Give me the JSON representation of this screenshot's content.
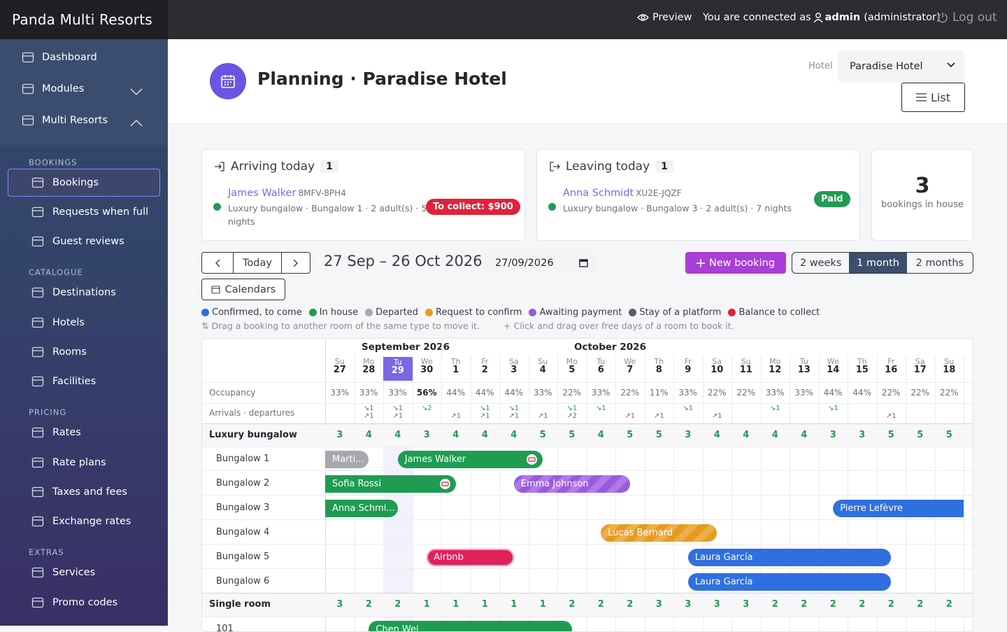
{
  "topbar": {
    "brand": "Panda Multi Resorts",
    "preview": "Preview",
    "connected_prefix": "You are connected as",
    "user": "admin",
    "role": "(administrator)",
    "logout": "Log out"
  },
  "sidebar": {
    "top": [
      {
        "label": "Dashboard",
        "icon": "dashboard-icon"
      },
      {
        "label": "Modules",
        "icon": "modules-icon"
      },
      {
        "label": "Multi Resorts",
        "icon": "building-icon"
      }
    ],
    "sections": [
      {
        "title": "BOOKINGS",
        "items": [
          {
            "label": "Bookings",
            "icon": "calendar-icon",
            "active": true
          },
          {
            "label": "Requests when full",
            "icon": "envelope-icon"
          },
          {
            "label": "Guest reviews",
            "icon": "star-icon"
          }
        ]
      },
      {
        "title": "CATALOGUE",
        "items": [
          {
            "label": "Destinations",
            "icon": "map-icon"
          },
          {
            "label": "Hotels",
            "icon": "hotel-icon"
          },
          {
            "label": "Rooms",
            "icon": "bed-icon"
          },
          {
            "label": "Facilities",
            "icon": "bell-icon"
          }
        ]
      },
      {
        "title": "PRICING",
        "items": [
          {
            "label": "Rates",
            "icon": "coins-icon"
          },
          {
            "label": "Rate plans",
            "icon": "tag-icon"
          },
          {
            "label": "Taxes and fees",
            "icon": "receipt-icon"
          },
          {
            "label": "Exchange rates",
            "icon": "exchange-icon"
          }
        ]
      },
      {
        "title": "EXTRAS",
        "items": [
          {
            "label": "Services",
            "icon": "service-icon"
          },
          {
            "label": "Promo codes",
            "icon": "ticket-icon"
          }
        ]
      }
    ]
  },
  "header": {
    "title": "Planning · Paradise Hotel",
    "hotel_label": "Hotel",
    "hotel_value": "Paradise Hotel",
    "list_button": "List"
  },
  "arriving": {
    "title": "Arriving today",
    "count": "1",
    "guest": "James Walker",
    "ref": "8MFV-8PH4",
    "detail_line1": "Luxury bungalow · Bungalow 1 · 2 adult(s) · 5",
    "detail_line2": "nights",
    "badge": "To collect: $900",
    "badge_color": "#e0213a"
  },
  "leaving": {
    "title": "Leaving today",
    "count": "1",
    "guest": "Anna Schmidt",
    "ref": "XU2E-JQZF",
    "detail": "Luxury bungalow · Bungalow 3 · 2 adult(s) · 7 nights",
    "badge": "Paid",
    "badge_color": "#1f9c52"
  },
  "inhouse": {
    "count": "3",
    "label": "bookings in house"
  },
  "toolbar": {
    "today": "Today",
    "range": "27 Sep – 26 Oct 2026",
    "date_value": "27/09/2026",
    "new_booking": "New booking",
    "views": [
      "2 weeks",
      "1 month",
      "2 months"
    ],
    "active_view": "1 month",
    "calendars": "Calendars"
  },
  "legend": [
    {
      "label": "Confirmed, to come",
      "color": "#2f6fe0"
    },
    {
      "label": "In house",
      "color": "#1f9c52"
    },
    {
      "label": "Departed",
      "color": "#a6a8ae"
    },
    {
      "label": "Request to confirm",
      "color": "#e69b1e"
    },
    {
      "label": "Awaiting payment",
      "color": "#9b59e0"
    },
    {
      "label": "Stay of a platform",
      "color": "#5a5c64"
    },
    {
      "label": "Balance to collect",
      "color": "#e0213a"
    }
  ],
  "hints": [
    "⇅ Drag a booking to another room of the same type to move it.",
    "+ Click and drag over free days of a room to book it."
  ],
  "planning": {
    "months": [
      "September 2026",
      "October 2026"
    ],
    "days": [
      {
        "dn": "Su",
        "dd": "27"
      },
      {
        "dn": "Mo",
        "dd": "28"
      },
      {
        "dn": "Tu",
        "dd": "29"
      },
      {
        "dn": "We",
        "dd": "30"
      },
      {
        "dn": "Th",
        "dd": "1"
      },
      {
        "dn": "Fr",
        "dd": "2"
      },
      {
        "dn": "Sa",
        "dd": "3"
      },
      {
        "dn": "Su",
        "dd": "4"
      },
      {
        "dn": "Mo",
        "dd": "5"
      },
      {
        "dn": "Tu",
        "dd": "6"
      },
      {
        "dn": "We",
        "dd": "7"
      },
      {
        "dn": "Th",
        "dd": "8"
      },
      {
        "dn": "Fr",
        "dd": "9"
      },
      {
        "dn": "Sa",
        "dd": "10"
      },
      {
        "dn": "Su",
        "dd": "11"
      },
      {
        "dn": "Mo",
        "dd": "12"
      },
      {
        "dn": "Tu",
        "dd": "13"
      },
      {
        "dn": "We",
        "dd": "14"
      },
      {
        "dn": "Th",
        "dd": "15"
      },
      {
        "dn": "Fr",
        "dd": "16"
      },
      {
        "dn": "Sa",
        "dd": "17"
      },
      {
        "dn": "Su",
        "dd": "18"
      }
    ],
    "today_index": 2,
    "occupancy_label": "Occupancy",
    "occupancy": [
      "33%",
      "33%",
      "33%",
      "56%",
      "44%",
      "44%",
      "44%",
      "33%",
      "22%",
      "33%",
      "22%",
      "11%",
      "33%",
      "22%",
      "22%",
      "33%",
      "33%",
      "44%",
      "44%",
      "22%",
      "22%",
      "22%"
    ],
    "arrivals_label": "Arrivals · departures",
    "arrivals": [
      [
        "",
        ""
      ],
      [
        "↘1",
        "↗1"
      ],
      [
        "↘1",
        "↗1"
      ],
      [
        "↘2",
        ""
      ],
      [
        "",
        "↗1"
      ],
      [
        "↘1",
        "↗1"
      ],
      [
        "↘1",
        "↗1"
      ],
      [
        "",
        "↗1"
      ],
      [
        "↘1",
        "↗2"
      ],
      [
        "↘1",
        ""
      ],
      [
        "",
        "↗1"
      ],
      [
        "",
        "↗1"
      ],
      [
        "↘1",
        ""
      ],
      [
        "",
        "↗1"
      ],
      [
        "",
        ""
      ],
      [
        "↘1",
        ""
      ],
      [
        "",
        ""
      ],
      [
        "↘1",
        ""
      ],
      [
        "",
        ""
      ],
      [
        "",
        "↗1"
      ],
      [
        "",
        ""
      ],
      [
        "",
        ""
      ]
    ],
    "types": [
      {
        "name": "Luxury bungalow",
        "counts": [
          "3",
          "4",
          "4",
          "3",
          "4",
          "4",
          "4",
          "5",
          "5",
          "4",
          "5",
          "5",
          "3",
          "4",
          "4",
          "4",
          "4",
          "3",
          "3",
          "5",
          "5",
          "5"
        ],
        "rooms": [
          "Bungalow 1",
          "Bungalow 2",
          "Bungalow 3",
          "Bungalow 4",
          "Bungalow 5",
          "Bungalow 6"
        ]
      },
      {
        "name": "Single room",
        "counts": [
          "3",
          "2",
          "2",
          "1",
          "1",
          "1",
          "1",
          "1",
          "2",
          "2",
          "2",
          "3",
          "3",
          "3",
          "3",
          "2",
          "2",
          "2",
          "2",
          "2",
          "2",
          "2"
        ],
        "rooms": [
          "101"
        ]
      }
    ],
    "bookings": [
      {
        "room": 0,
        "start": 0,
        "end": 1.5,
        "label": "Marti...",
        "status": "departed",
        "color": "#a6a8ae"
      },
      {
        "room": 0,
        "start": 2.5,
        "end": 7.5,
        "label": "James Walker",
        "status": "in-house",
        "color": "#1f9c52",
        "balance": true
      },
      {
        "room": 1,
        "start": 0,
        "end": 4.5,
        "label": "Sofia Rossi",
        "status": "in-house",
        "color": "#1f9c52",
        "balance": true
      },
      {
        "room": 1,
        "start": 6.5,
        "end": 10.5,
        "label": "Emma Johnson",
        "status": "awaiting-payment",
        "color": "#9b59e0"
      },
      {
        "room": 2,
        "start": 0,
        "end": 2.5,
        "label": "Anna Schmi...",
        "status": "in-house",
        "color": "#1f9c52"
      },
      {
        "room": 2,
        "start": 17.5,
        "end": 22,
        "label": "Pierre Lefèvre",
        "status": "confirmed",
        "color": "#2f6fe0"
      },
      {
        "room": 3,
        "start": 9.5,
        "end": 13.5,
        "label": "Lucas Bernard",
        "status": "request",
        "color": "#e69b1e"
      },
      {
        "room": 4,
        "start": 3.5,
        "end": 6.5,
        "label": "Airbnb",
        "status": "platform",
        "color": "#e0215a"
      },
      {
        "room": 4,
        "start": 12.5,
        "end": 19.5,
        "label": "Laura García",
        "status": "confirmed",
        "color": "#2f6fe0"
      },
      {
        "room": 5,
        "start": 12.5,
        "end": 19.5,
        "label": "Laura García",
        "status": "confirmed",
        "color": "#2f6fe0"
      },
      {
        "room": 6,
        "start": 1.5,
        "end": 8.5,
        "label": "Chen Wei",
        "status": "in-house",
        "color": "#1f9c52"
      }
    ]
  }
}
